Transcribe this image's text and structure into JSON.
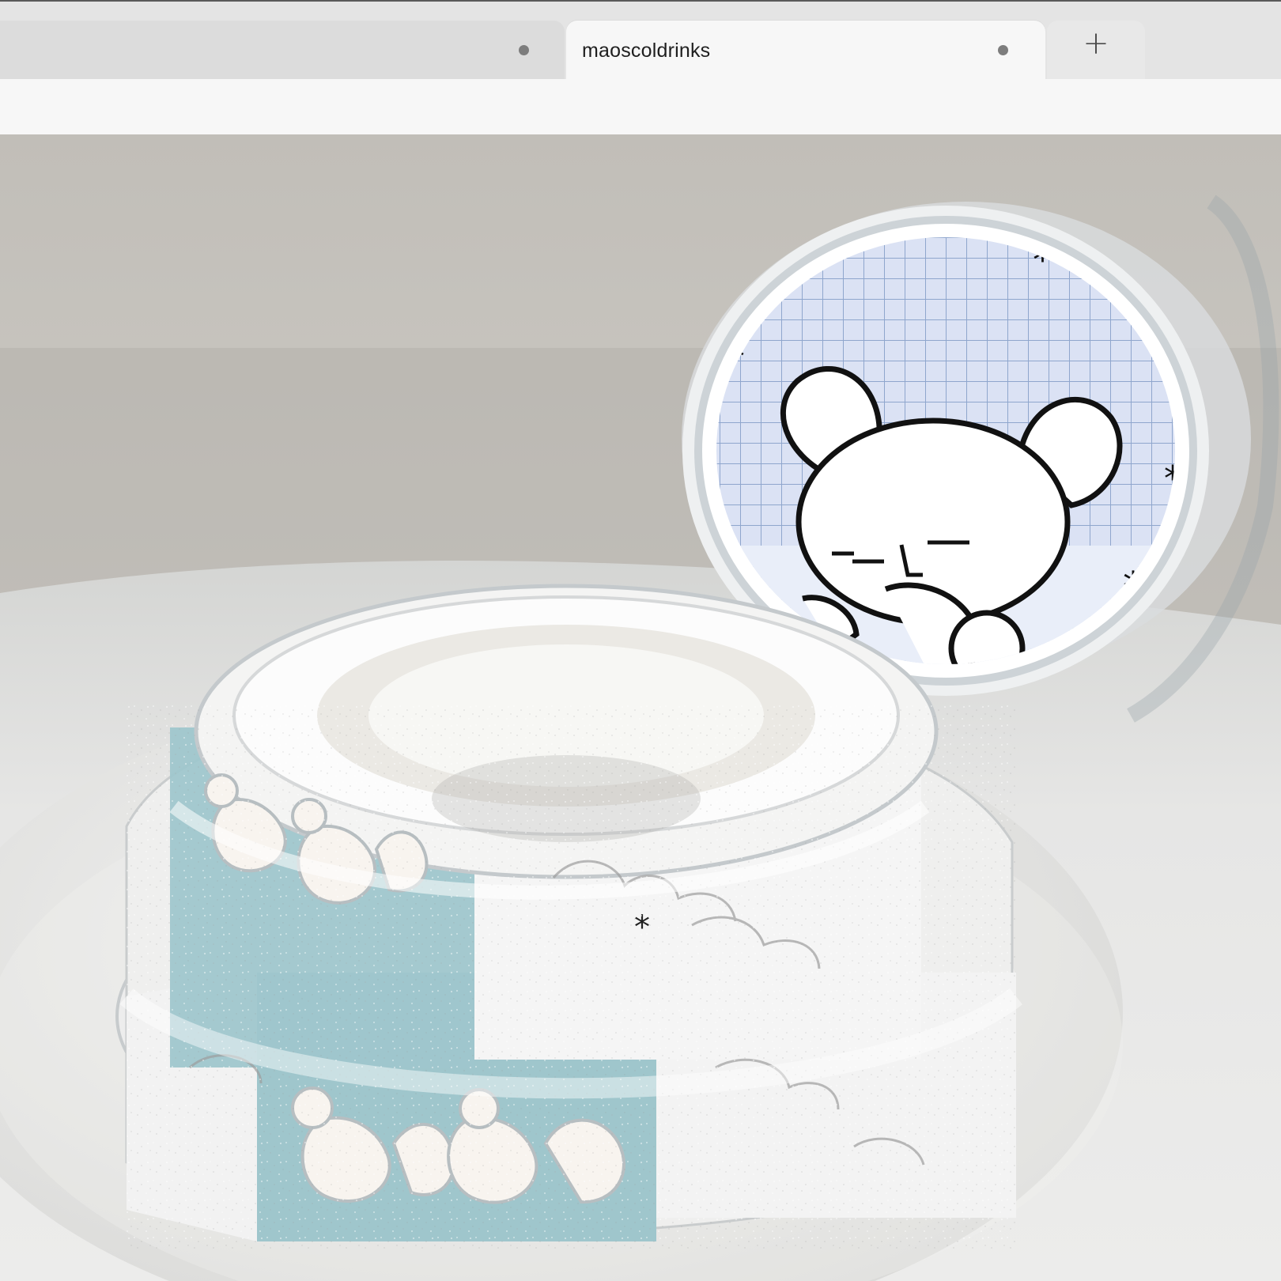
{
  "browser": {
    "tabs": [
      {
        "title": "",
        "active": false,
        "indicator": "dot-icon"
      },
      {
        "title": "maoscoldrinks",
        "active": true,
        "indicator": "dot-icon"
      }
    ],
    "new_tab_label": "+"
  },
  "content": {
    "image_subject": "photo of glitter washi tape rolls with squirrel and mouse illustrations"
  },
  "colors": {
    "tab_strip": "#e4e4e4",
    "active_tab": "#f7f7f7",
    "inactive_tab": "#dcdcdc",
    "tape_blue": "#9fc6cc",
    "grid_blue": "#c9d6ee",
    "background_wall": "#c8c4bd",
    "table": "#e8e8e8"
  }
}
